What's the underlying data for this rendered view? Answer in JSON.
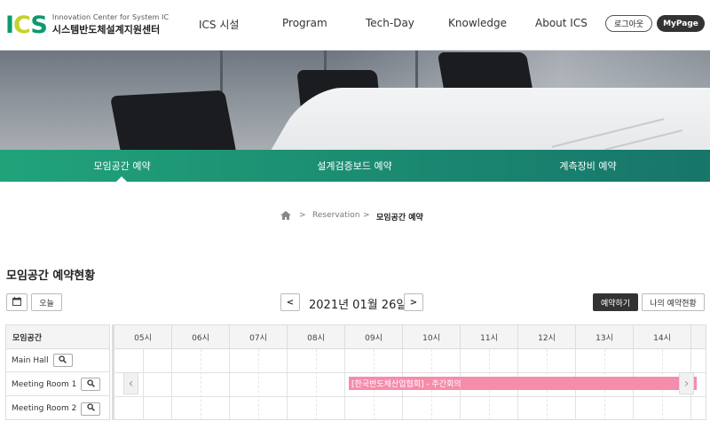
{
  "header": {
    "logo_mark": [
      "I",
      "C",
      "S"
    ],
    "logo_en": "Innovation Center for System IC",
    "logo_kr": "시스템반도체설계지원센터",
    "nav": [
      "ICS 시설",
      "Program",
      "Tech-Day",
      "Knowledge",
      "About ICS"
    ],
    "logout_label": "로그아웃",
    "mypage_label": "MyPage"
  },
  "tabs": [
    {
      "label": "모임공간 예약",
      "active": true
    },
    {
      "label": "설계검증보드 예약",
      "active": false
    },
    {
      "label": "계측장비 예약",
      "active": false
    }
  ],
  "breadcrumb": {
    "home_icon": "home-icon",
    "level1": "Reservation",
    "current": "모임공간 예약",
    "separator": ">"
  },
  "section_title": "모임공간 예약현황",
  "controls": {
    "calendar_icon": "calendar-icon",
    "today_label": "오늘",
    "prev": "<",
    "next": ">",
    "date": "2021년 01월 26일",
    "reserve_label": "예약하기",
    "my_reservations_label": "나의 예약현황"
  },
  "schedule": {
    "rooms_header": "모임공간",
    "rooms": [
      "Main Hall",
      "Meeting Room 1",
      "Meeting Room 2"
    ],
    "hours": [
      "05시",
      "06시",
      "07시",
      "08시",
      "09시",
      "10시",
      "11시",
      "12시",
      "13시",
      "14시"
    ],
    "events": [
      {
        "room": "Meeting Room 1",
        "start": "09:00",
        "end": "15:00",
        "label": "[한국반도체산업협회] - 주간회의",
        "color": "#f68cac"
      }
    ],
    "scroll_left": "‹",
    "scroll_right": "›"
  },
  "colors": {
    "brand_green": "#0d9a6e",
    "brand_lime": "#c6d12a",
    "tab_bar_start": "#21a37a",
    "tab_bar_end": "#17756a",
    "event_pink": "#f68cac"
  }
}
